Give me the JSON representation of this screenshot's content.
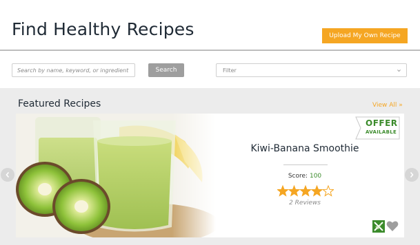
{
  "header": {
    "title": "Find Healthy Recipes",
    "upload_label": "Upload My Own Recipe"
  },
  "search": {
    "placeholder": "Search by name, keyword, or ingredient",
    "button_label": "Search"
  },
  "filter": {
    "selected": "Filter"
  },
  "featured": {
    "title": "Featured Recipes",
    "view_all": "View All »",
    "recipe": {
      "name": "Kiwi-Banana Smoothie",
      "score_label": "Score:",
      "score_value": "100",
      "rating": 4,
      "rating_max": 5,
      "reviews": "2 Reviews",
      "offer_line1": "OFFER",
      "offer_line2": "AVAILABLE"
    }
  },
  "colors": {
    "accent_orange": "#f5a623",
    "offer_green": "#3b8b2b",
    "star_orange": "#f5a623"
  },
  "icons": {
    "left": "chevron-left-icon",
    "right": "chevron-right-icon",
    "filter_dropdown": "chevron-down-icon",
    "diet": "diet-icon",
    "favorite": "heart-icon"
  }
}
